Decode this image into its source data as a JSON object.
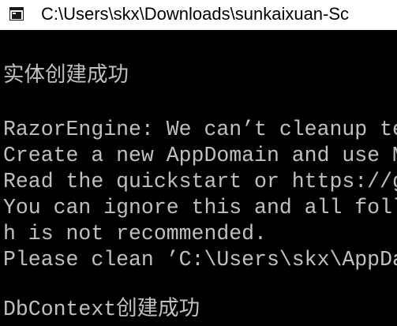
{
  "window": {
    "title": "C:\\Users\\skx\\Downloads\\sunkaixuan-Sc"
  },
  "icons": {
    "app": "console-app-icon"
  },
  "colors": {
    "titlebar_bg": "#ffffff",
    "console_bg": "#000000",
    "console_text": "#c0c0c0"
  },
  "console": {
    "lines": [
      "实体创建成功",
      "RazorEngine: We can’t cleanup te",
      "Create a new AppDomain and use M",
      "Read the quickstart or https://g",
      "You can ignore this and all foll",
      "h is not recommended.",
      "Please clean ’C:\\Users\\skx\\AppDa",
      "DbContext创建成功"
    ]
  }
}
